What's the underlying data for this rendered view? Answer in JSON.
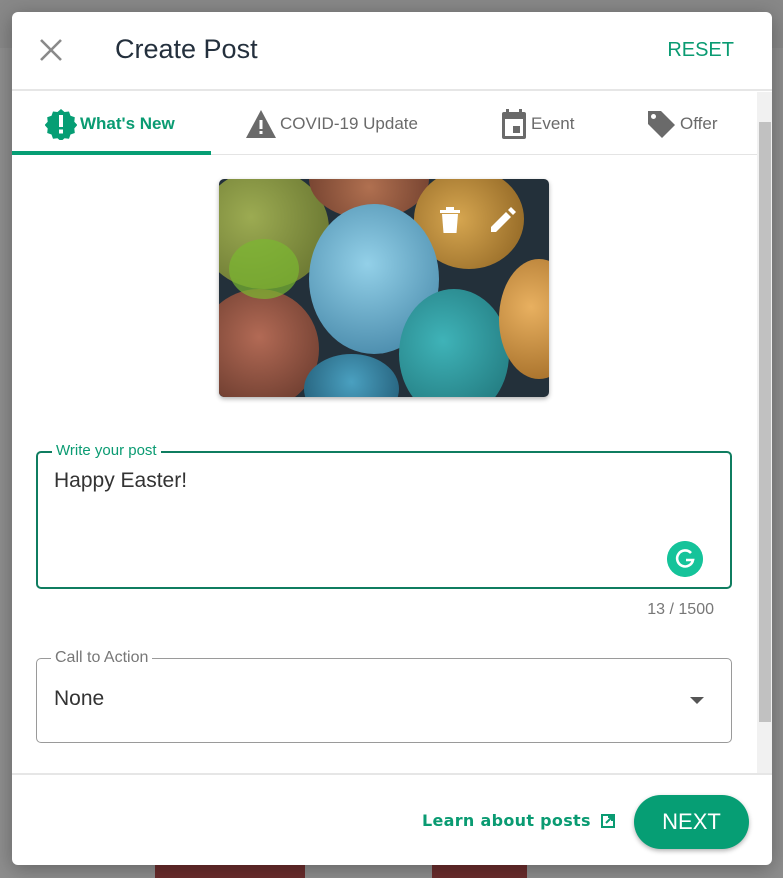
{
  "header": {
    "title": "Create Post",
    "reset_label": "RESET"
  },
  "tabs": [
    {
      "label": "What's New",
      "icon": "badge-alert-icon",
      "active": true
    },
    {
      "label": "COVID-19 Update",
      "icon": "warning-icon",
      "active": false
    },
    {
      "label": "Event",
      "icon": "calendar-icon",
      "active": false
    },
    {
      "label": "Offer",
      "icon": "tag-icon",
      "active": false
    }
  ],
  "post": {
    "label": "Write your post",
    "value": "Happy Easter!",
    "counter": "13 / 1500"
  },
  "cta": {
    "label": "Call to Action",
    "value": "None"
  },
  "footer": {
    "learn_label": "Learn about posts",
    "next_label": "NEXT"
  },
  "colors": {
    "accent": "#069e74",
    "title": "#24303d"
  }
}
